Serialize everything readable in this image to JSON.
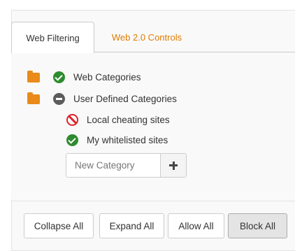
{
  "tabs": [
    {
      "label": "Web Filtering",
      "active": true
    },
    {
      "label": "Web 2.0 Controls",
      "active": false
    }
  ],
  "tree": {
    "web_categories": {
      "label": "Web Categories",
      "folder_icon": "folder-icon",
      "status_icon": "check-circle-icon"
    },
    "user_defined": {
      "label": "User Defined Categories",
      "folder_icon": "folder-open-icon",
      "status_icon": "minus-circle-icon"
    },
    "children": [
      {
        "label": "Local cheating sites",
        "status_icon": "ban-icon"
      },
      {
        "label": "My whitelisted sites",
        "status_icon": "check-circle-icon"
      }
    ]
  },
  "new_category": {
    "placeholder": "New Category",
    "value": ""
  },
  "actions": {
    "collapse_all": "Collapse All",
    "expand_all": "Expand All",
    "allow_all": "Allow All",
    "block_all": "Block All"
  },
  "colors": {
    "accent": "#e07b00",
    "folder": "#e98a1a",
    "allow": "#2e8b2e",
    "block": "#e0202a",
    "mixed": "#5c5c5c"
  }
}
